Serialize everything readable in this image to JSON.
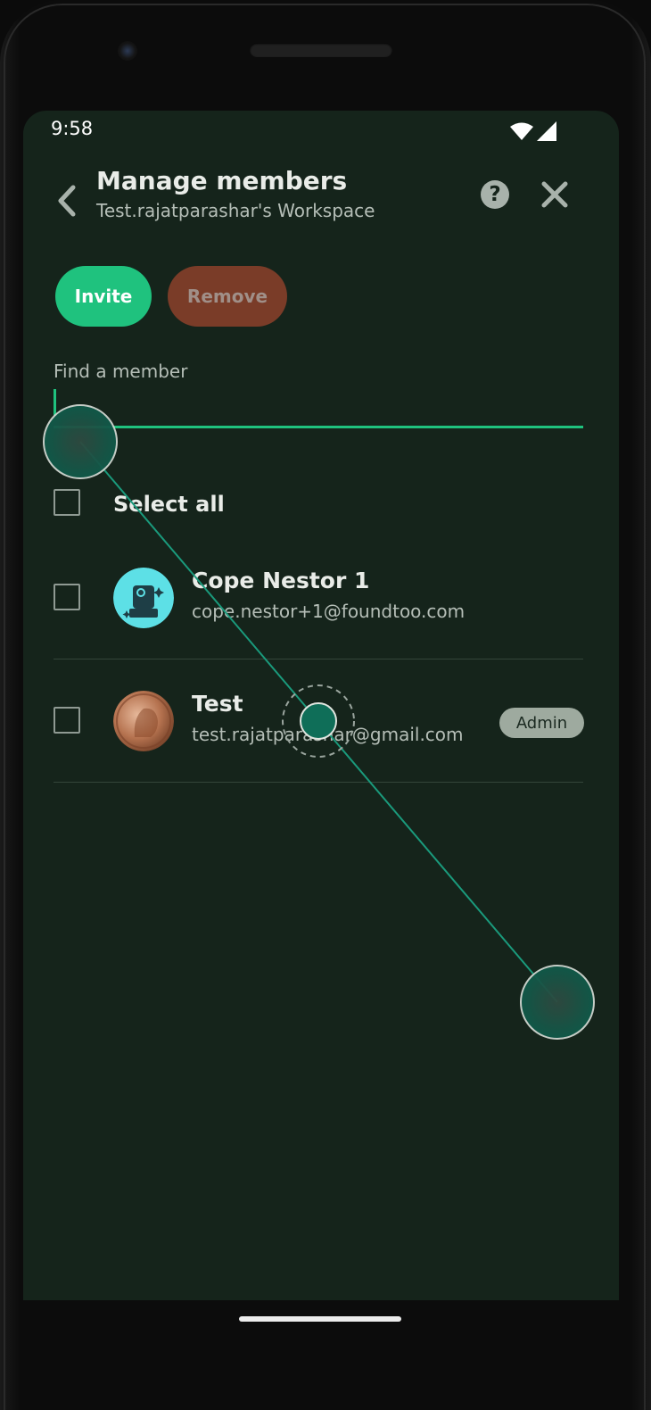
{
  "status_bar": {
    "time": "9:58"
  },
  "header": {
    "title": "Manage members",
    "subtitle": "Test.rajatparashar's Workspace",
    "back_icon": "chevron-left-icon",
    "help_icon": "help-circle-icon",
    "close_icon": "close-icon"
  },
  "actions": {
    "invite_label": "Invite",
    "remove_label": "Remove"
  },
  "search": {
    "label": "Find a member",
    "value": ""
  },
  "select_all": {
    "label": "Select all",
    "checked": false
  },
  "members": [
    {
      "name": "Cope Nestor 1",
      "email": "cope.nestor+1@foundtoo.com",
      "role": "",
      "checked": false,
      "avatar": "robot-illustration"
    },
    {
      "name": "Test",
      "email": "test.rajatparashar@gmail.com",
      "role": "Admin",
      "checked": false,
      "avatar": "coin-photo"
    }
  ],
  "colors": {
    "background": "#15241b",
    "accent": "#1fc27e",
    "remove": "#7a3c28",
    "text_primary": "#e9ece8",
    "text_secondary": "#b5beb7"
  }
}
